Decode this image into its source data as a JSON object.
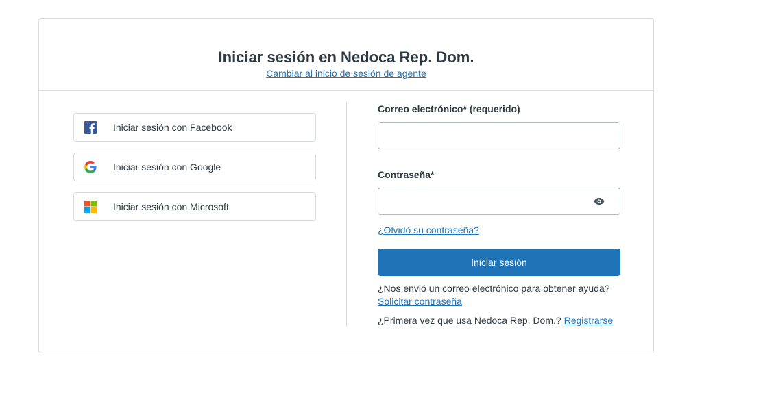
{
  "header": {
    "title": "Iniciar sesión en Nedoca Rep. Dom.",
    "agent_link": "Cambiar al inicio de sesión de agente"
  },
  "social": [
    {
      "label": "Iniciar sesión con Facebook",
      "icon": "facebook-icon"
    },
    {
      "label": "Iniciar sesión con Google",
      "icon": "google-icon"
    },
    {
      "label": "Iniciar sesión con Microsoft",
      "icon": "microsoft-icon"
    }
  ],
  "form": {
    "email_label": "Correo electrónico* (requerido)",
    "email_value": "",
    "password_label": "Contraseña*",
    "password_value": "",
    "forgot_link": "¿Olvidó su contraseña?",
    "submit_label": "Iniciar sesión",
    "help_text": "¿Nos envió un correo electrónico para obtener ayuda?",
    "request_link": "Solicitar contraseña",
    "first_time_text": "¿Primera vez que usa Nedoca Rep. Dom.?",
    "register_link": "Registrarse"
  },
  "colors": {
    "accent": "#1f73b7",
    "border": "#d8dcde",
    "text": "#2f3941"
  }
}
